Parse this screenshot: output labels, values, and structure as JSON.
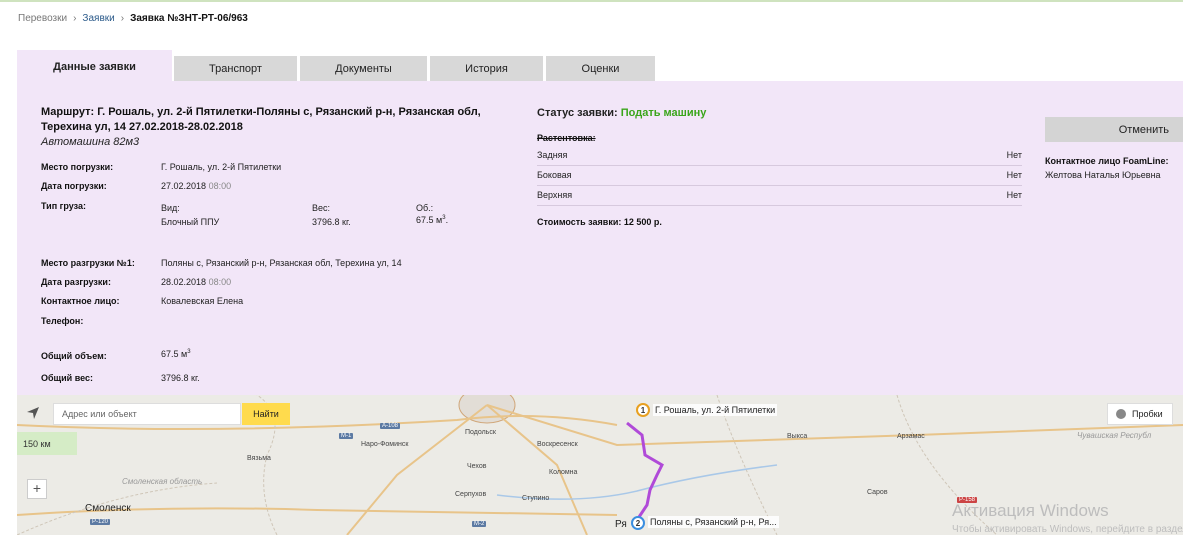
{
  "breadcrumbs": {
    "root": "Перевозки",
    "link": "Заявки",
    "current": "Заявка №ЗНТ-РТ-06/963"
  },
  "tabs": [
    "Данные заявки",
    "Транспорт",
    "Документы",
    "История",
    "Оценки"
  ],
  "order": {
    "route_line1": "Маршрут: Г. Рошаль, ул. 2-й Пятилетки-Поляны с, Рязанский р-н, Рязанская обл,",
    "route_line2": "Терехина ул, 14 27.02.2018-28.02.2018",
    "vehicle": "Автомашина 82м3",
    "loading_place_label": "Место погрузки:",
    "loading_place": "Г. Рошаль, ул. 2-й Пятилетки",
    "loading_date_label": "Дата погрузки:",
    "loading_date": "27.02.2018",
    "loading_time": "08:00",
    "cargo_type_label": "Тип груза:",
    "cargo_kind_label": "Вид:",
    "cargo_kind": "Блочный ППУ",
    "cargo_weight_label": "Вес:",
    "cargo_weight": "3796.8 кг.",
    "cargo_volume_label": "Об.:",
    "cargo_volume": "67.5 м",
    "volume_exp": "3",
    "volume_suffix": ".",
    "unloading_place_label": "Место разгрузки №1:",
    "unloading_place": "Поляны с, Рязанский р-н, Рязанская обл, Терехина ул, 14",
    "unloading_date_label": "Дата разгрузки:",
    "unloading_date": "28.02.2018",
    "unloading_time": "08:00",
    "contact_label": "Контактное лицо:",
    "contact": "Ковалевская Елена",
    "phone_label": "Телефон:",
    "total_volume_label": "Общий объем:",
    "total_volume": "67.5 м",
    "total_weight_label": "Общий вес:",
    "total_weight": "3796.8 кг."
  },
  "status": {
    "label": "Статус заявки:",
    "value": "Подать машину",
    "color": "#3aa51a",
    "rastentovka_title": "Растентовка:",
    "rows": [
      {
        "name": "Задняя",
        "value": "Нет"
      },
      {
        "name": "Боковая",
        "value": "Нет"
      },
      {
        "name": "Верхняя",
        "value": "Нет"
      }
    ],
    "cost": "Стоимость заявки: 12 500 р."
  },
  "side": {
    "cancel_label": "Отменить",
    "contact_label": "Контактное лицо FoamLine:",
    "contact_name": "Желтова Наталья Юрьевна"
  },
  "map": {
    "search_placeholder": "Адрес или объект",
    "find_label": "Найти",
    "scale": "150 км",
    "traffic_label": "Пробки",
    "zoom_in": "+",
    "route_color": "#b04ad8",
    "marker1_num": "1",
    "marker1_label": "Г. Рошаль, ул. 2-й Пятилетки",
    "marker2_num": "2",
    "marker2_label": "Поляны с, Рязанский р-н, Ря...",
    "cities": {
      "vyazma": "Вязьма",
      "smolensk": "Смоленск",
      "naro": "Наро-Фоминск",
      "podolsk": "Подольск",
      "voskresensk": "Воскресенск",
      "chekhov": "Чехов",
      "kolomna": "Коломна",
      "serpukhov": "Серпухов",
      "stupino": "Ступино",
      "ryaz": "Ря",
      "vyksa": "Выкса",
      "arzamas": "Арзамас",
      "sarov": "Саров",
      "smolensk_region": "Смоленская область",
      "chuvash": "Чувашская Республ"
    },
    "roads": {
      "m1": "М-1",
      "a108": "А-108",
      "m2": "М-2",
      "p120": "Р-120",
      "p158": "Р-158"
    }
  },
  "watermark": {
    "line1": "Активация Windows",
    "line2": "Чтобы активировать Windows, перейдите в раздел"
  }
}
